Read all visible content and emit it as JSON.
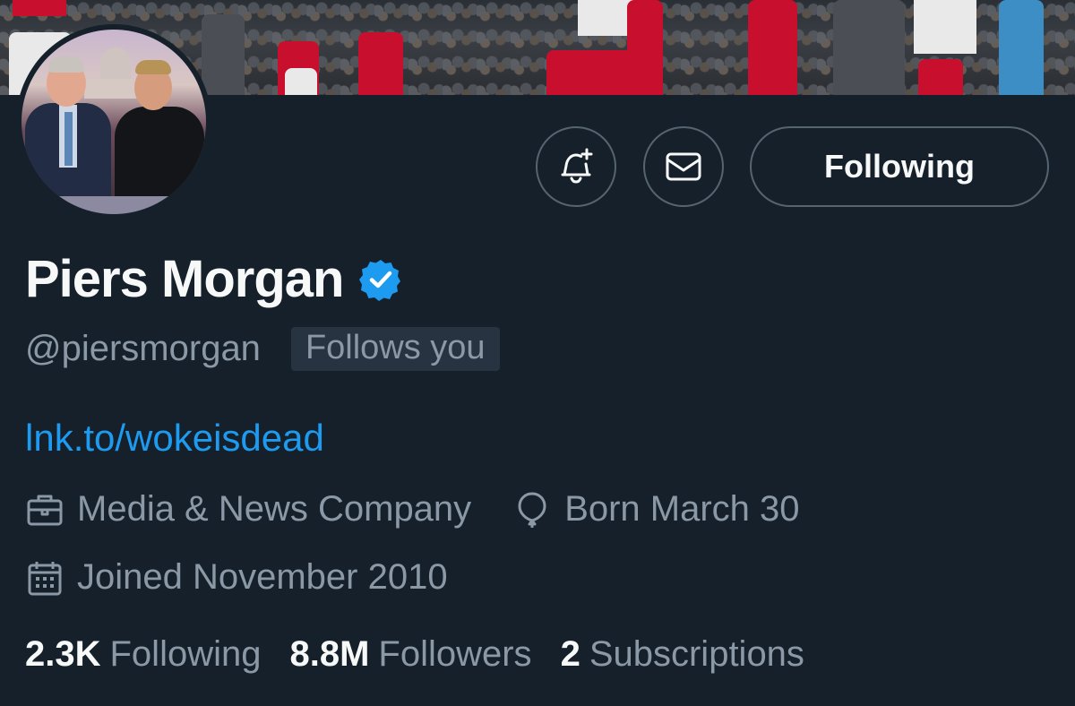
{
  "profile": {
    "name": "Piers Morgan",
    "handle": "@piersmorgan",
    "follows_you_label": "Follows you",
    "link": "lnk.to/wokeisdead",
    "category": "Media & News Company",
    "birth": "Born March 30",
    "joined": "Joined November 2010",
    "verified": true
  },
  "actions": {
    "notify_icon": "bell-plus-icon",
    "message_icon": "envelope-icon",
    "following_label": "Following"
  },
  "stats": [
    {
      "value": "2.3K",
      "label": "Following"
    },
    {
      "value": "8.8M",
      "label": "Followers"
    },
    {
      "value": "2",
      "label": "Subscriptions"
    }
  ],
  "icons": {
    "category": "briefcase-icon",
    "birth": "balloon-icon",
    "joined": "calendar-icon",
    "verified": "verified-badge-icon"
  },
  "colors": {
    "background": "#15202b",
    "accent": "#1d9bf0",
    "muted_text": "#8b98a5",
    "primary_text": "#f7f9f9"
  }
}
